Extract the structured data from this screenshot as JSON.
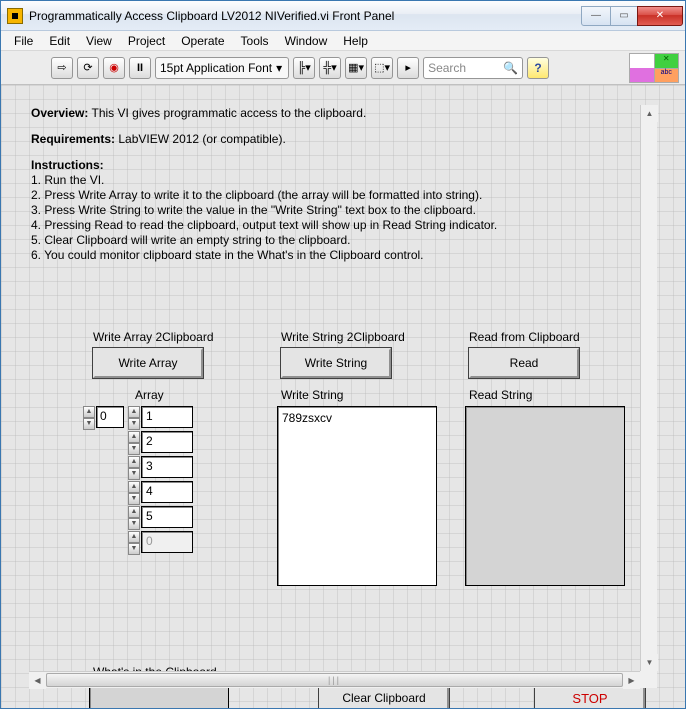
{
  "window": {
    "title": "Programmatically Access Clipboard LV2012 NIVerified.vi Front Panel"
  },
  "menu": {
    "items": [
      "File",
      "Edit",
      "View",
      "Project",
      "Operate",
      "Tools",
      "Window",
      "Help"
    ]
  },
  "toolbar": {
    "font_label": "15pt Application Font",
    "search_placeholder": "Search"
  },
  "text": {
    "overview_label": "Overview:",
    "overview_body": " This VI gives programmatic access to the clipboard.",
    "requirements_label": "Requirements:",
    "requirements_body": " LabVIEW 2012 (or compatible).",
    "instructions_label": "Instructions:",
    "instructions": [
      "1. Run the VI.",
      "2. Press Write Array to write it to the clipboard (the array will be formatted into string).",
      "3. Press Write String to write the value in the \"Write String\" text box to the clipboard.",
      "4. Pressing Read to read the clipboard, output text will show up in Read String indicator.",
      "5. Clear Clipboard will write an empty string to the clipboard.",
      "6. You could monitor clipboard state in the What's in the Clipboard control."
    ]
  },
  "labels": {
    "write_array_section": "Write Array 2Clipboard",
    "write_string_section": "Write String 2Clipboard",
    "read_section": "Read from Clipboard",
    "btn_write_array": "Write Array",
    "btn_write_string": "Write String",
    "btn_read": "Read",
    "array_label": "Array",
    "write_string_label": "Write String",
    "read_string_label": "Read String",
    "whats_label": "What's in the Clipboard",
    "btn_clear": "Clear Clipboard",
    "btn_stop": "STOP"
  },
  "values": {
    "array_index": "0",
    "array_items": [
      "1",
      "2",
      "3",
      "4",
      "5",
      "0"
    ],
    "write_string_value": "789zsxcv",
    "read_string_value": "",
    "whats_value": ""
  }
}
